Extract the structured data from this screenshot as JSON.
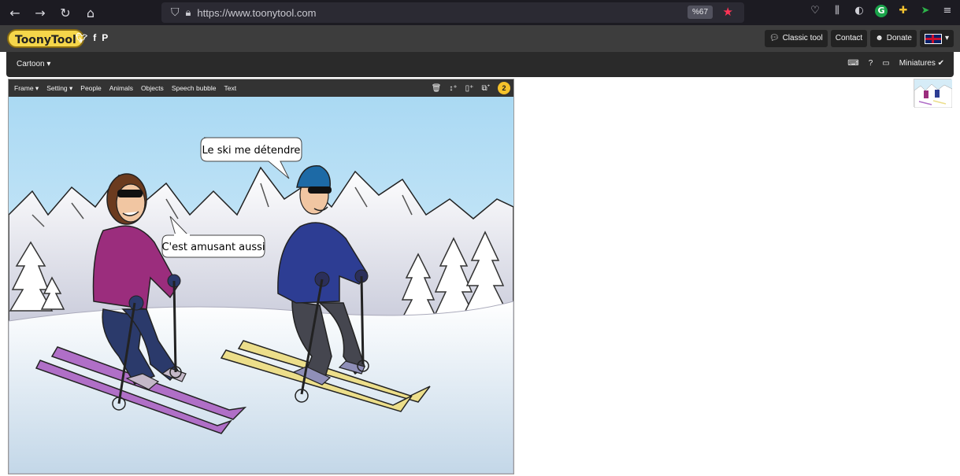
{
  "browser": {
    "nav": {
      "back": "←",
      "forward": "→",
      "reload": "↻",
      "home": "⌂"
    },
    "url": "https://www.toonytool.com",
    "zoom": "%67"
  },
  "site": {
    "logo": "ToonyTool",
    "social_icons": [
      "twitter-icon",
      "facebook-icon",
      "pinterest-icon"
    ],
    "buttons": {
      "classic": "Classic tool",
      "contact": "Contact",
      "donate": "Donate"
    }
  },
  "toolbar": {
    "category": "Cartoon ▾",
    "miniatures": "Miniatures ✔"
  },
  "editor": {
    "menu": [
      "Frame ▾",
      "Setting ▾",
      "People",
      "Animals",
      "Objects",
      "Speech bubble",
      "Text"
    ],
    "frame_count": "2",
    "bubbles": {
      "man": "Le ski me détendre",
      "woman": "C'est amusant aussi"
    }
  },
  "colors": {
    "browser_bg": "#1c1b22",
    "header_bg": "#3d3d3d",
    "toolbar_bg": "#2a2a2a",
    "logo_yellow": "#f5d64a",
    "sky": "#bfe2f5"
  }
}
